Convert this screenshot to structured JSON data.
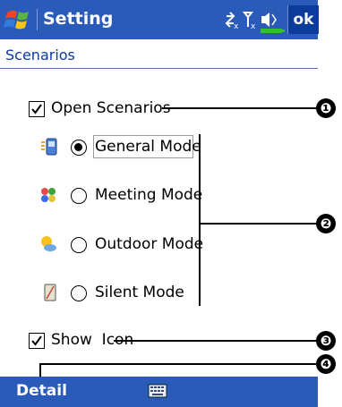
{
  "titlebar": {
    "app_title": "Setting",
    "ok_label": "ok",
    "icons": [
      "windows-start-icon",
      "connectivity-icon",
      "antenna-off-icon",
      "speaker-icon",
      "battery-icon"
    ]
  },
  "page": {
    "header": "Scenarios"
  },
  "options": {
    "open_scenarios": {
      "label": "Open Scenarios",
      "checked": true
    },
    "show_icon": {
      "label": "Show  Icon",
      "checked": true
    }
  },
  "modes": [
    {
      "label": "General Mode",
      "selected": true,
      "icon": "general-mode-icon"
    },
    {
      "label": "Meeting Mode",
      "selected": false,
      "icon": "meeting-mode-icon"
    },
    {
      "label": "Outdoor Mode",
      "selected": false,
      "icon": "outdoor-mode-icon"
    },
    {
      "label": "Silent Mode",
      "selected": false,
      "icon": "silent-mode-icon"
    }
  ],
  "callouts": [
    "❶",
    "❷",
    "❸",
    "❹"
  ],
  "bottombar": {
    "detail_label": "Detail",
    "keyboard_icon": "keyboard-icon"
  },
  "colors": {
    "bar": "#2a5bb9",
    "ok_bg": "#0c3b9a",
    "header_text": "#0b3aa6"
  }
}
